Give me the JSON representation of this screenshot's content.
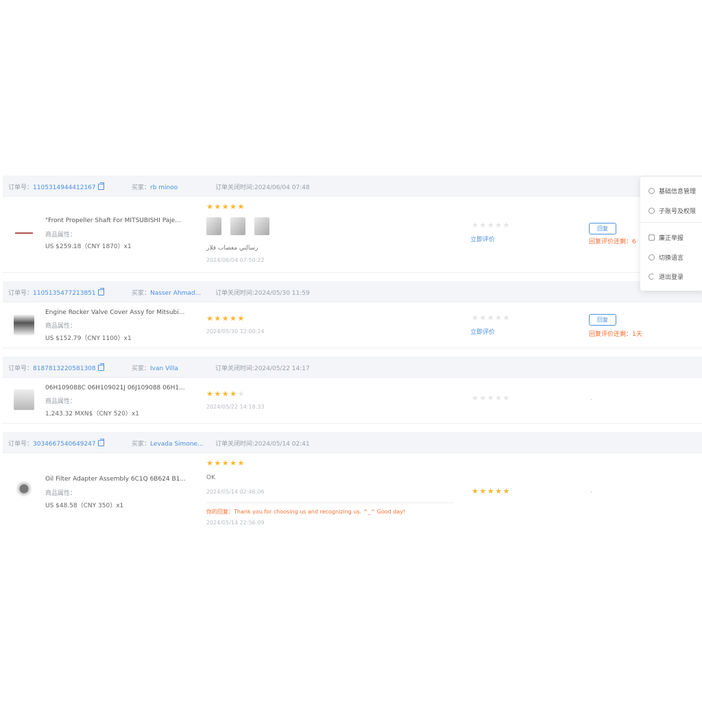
{
  "labels": {
    "order_no": "订单号：",
    "buyer": "买家：",
    "close_time": "订单关闭时间:",
    "attr": "商品属性：",
    "rate_now": "立即评价",
    "reply_button": "回复",
    "your_reply": "你的回复："
  },
  "orders": [
    {
      "order_no": "1105314944412167",
      "buyer": "rb minoo",
      "close_time": "2024/06/04 07:48",
      "product_title": "\"Front Propeller Shaft For MITSUBISHI Paje...",
      "price": "US $259.18（CNY  1870）x1",
      "buyer_stars": "★★★★★",
      "review_text": "رسالتي معصاب فلار",
      "review_date": "2024/06/04 07:50:22",
      "seller_stars": "★★★★★",
      "reply_deadline": "回复评价还剩：6"
    },
    {
      "order_no": "1105135477213851",
      "buyer": "Nasser Ahmad...",
      "close_time": "2024/05/30 11:59",
      "product_title": "Engine Rocker Valve Cover Assy for Mitsubi...",
      "price": "US $152.79（CNY  1100）x1",
      "buyer_stars": "★★★★★",
      "review_date": "2024/05/30 12:00:24",
      "seller_stars": "★★★★★",
      "reply_deadline": "回复评价还剩：1天"
    },
    {
      "order_no": "8187813220581308",
      "buyer": "Ivan Villa",
      "close_time": "2024/05/22 14:17",
      "product_title": "06H109088C 06H109021J 06J109088 06H1...",
      "price": "1,243.32 MXN$（CNY  520）x1",
      "buyer_stars_on": "★★★★",
      "buyer_stars_off": "★",
      "review_date": "2024/05/22 14:18:33",
      "seller_stars": "★★★★★",
      "status": "-"
    },
    {
      "order_no": "3034667540649247",
      "buyer": "Levada Simone...",
      "close_time": "2024/05/14 02:41",
      "product_title": "Oil Filter Adapter Assembly 6C1Q 6B624 B1...",
      "price": "US $48.58（CNY  350）x1",
      "buyer_stars": "★★★★★",
      "review_text": "OK",
      "review_date": "2024/05/14 02:46:06",
      "seller_reply": "Thank you for choosing us and recognizing us. ^_^ Good day!",
      "reply_date": "2024/05/14 22:56:09",
      "seller_stars": "★★★★★",
      "status": "-"
    }
  ],
  "menu": [
    {
      "label": "基础信息管理",
      "icon": "settings-icon"
    },
    {
      "label": "子账号及权限",
      "icon": "users-icon"
    },
    {
      "label": "廉正举报",
      "icon": "report-icon"
    },
    {
      "label": "切换语言",
      "icon": "globe-icon"
    },
    {
      "label": "退出登录",
      "icon": "logout-icon"
    }
  ],
  "colors": {
    "link": "#4a90e2",
    "star": "#f7b733",
    "star_off": "#e3e5e8",
    "warning": "#f36d31",
    "header_bg": "#f3f5f8"
  }
}
